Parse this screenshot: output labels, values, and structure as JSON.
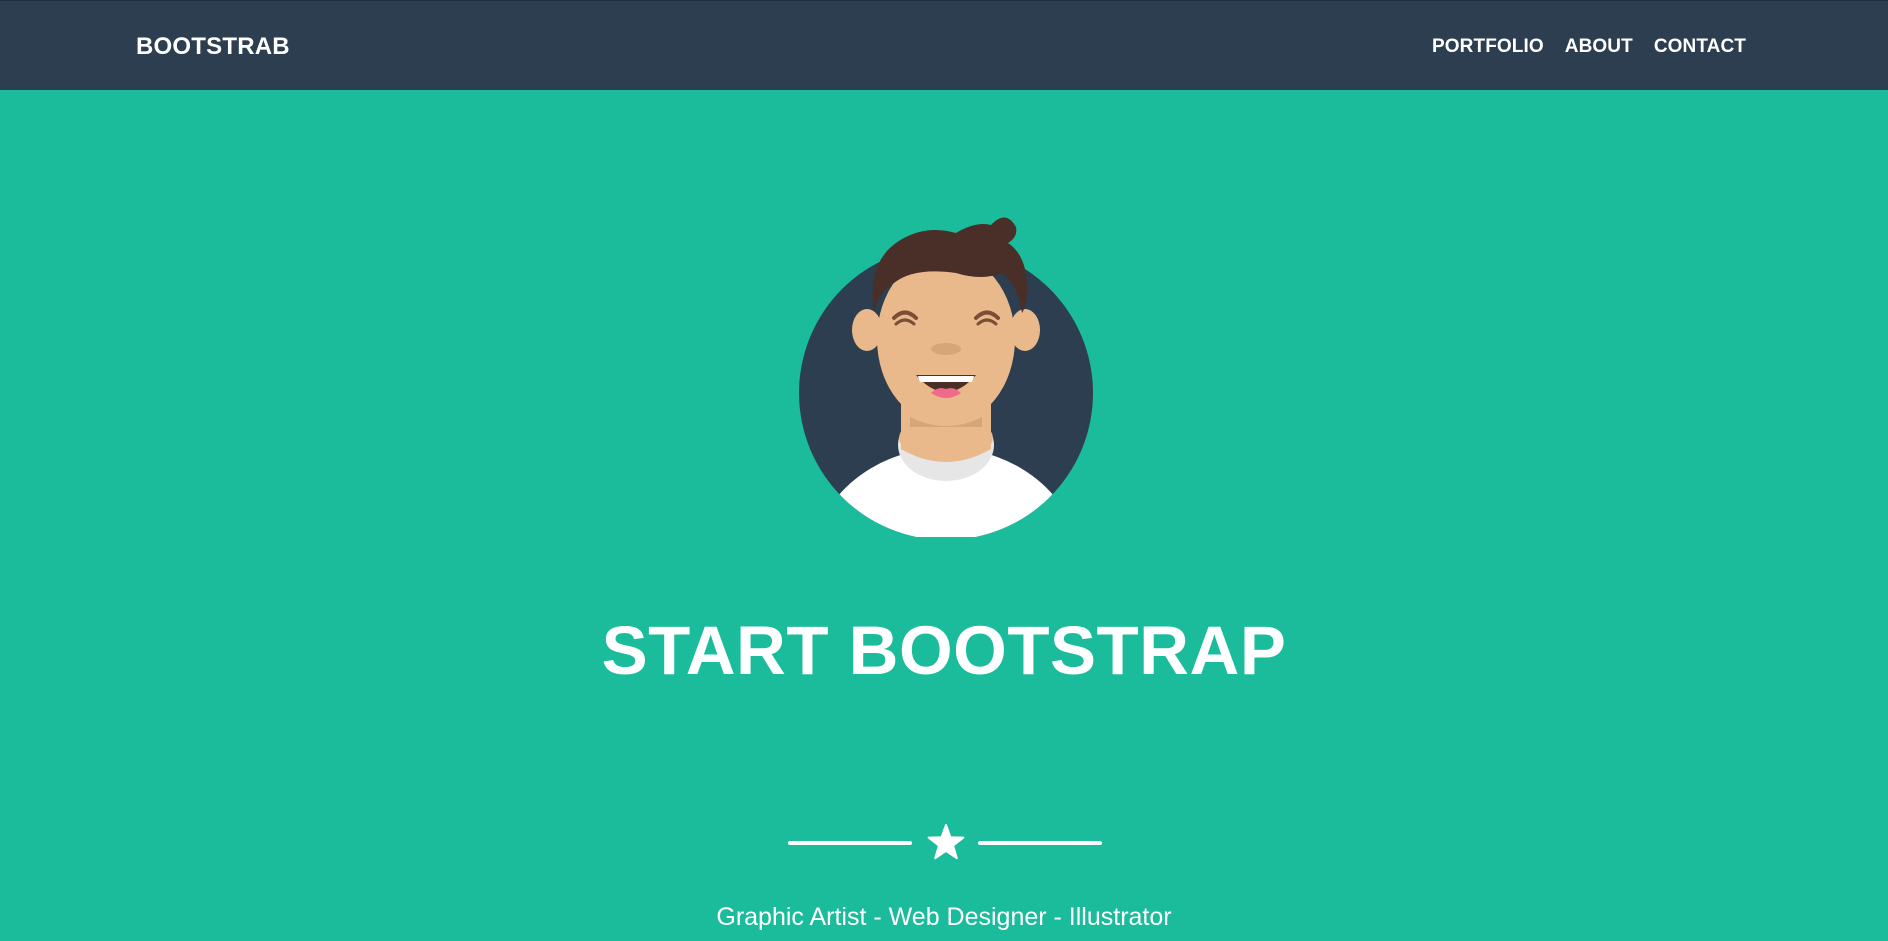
{
  "navbar": {
    "brand": "BOOTSTRAB",
    "links": [
      "PORTFOLIO",
      "ABOUT",
      "CONTACT"
    ]
  },
  "hero": {
    "avatar_icon": "avatar-illustration",
    "title": "START BOOTSTRAP",
    "divider_icon": "star-icon",
    "subtitle": "Graphic Artist - Web Designer - Illustrator"
  },
  "colors": {
    "navbar_bg": "#2c3e50",
    "hero_bg": "#1abc9c",
    "text": "#ffffff"
  }
}
